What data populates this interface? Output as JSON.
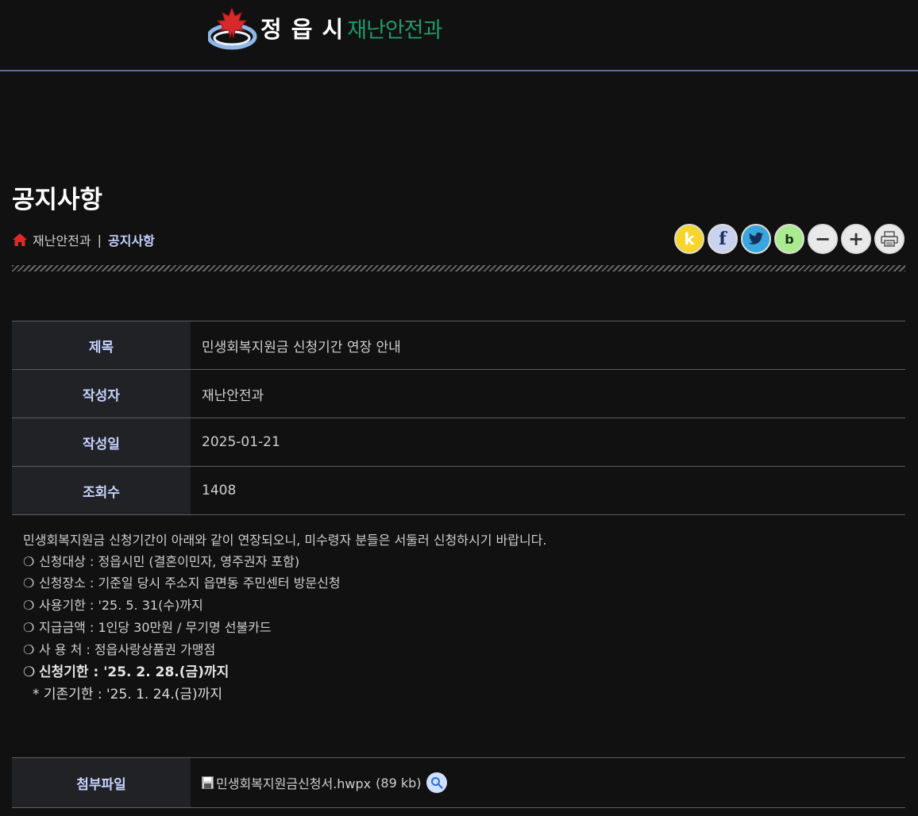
{
  "header": {
    "city": "정 읍 시",
    "dept": "재난안전과"
  },
  "page": {
    "title": "공지사항"
  },
  "breadcrumb": {
    "home_item": "재난안전과",
    "separator": "|",
    "current": "공지사항"
  },
  "tools": [
    {
      "name": "kakao-share-button",
      "icon": "kakao-icon",
      "glyph": "k"
    },
    {
      "name": "facebook-share-button",
      "icon": "facebook-icon",
      "glyph": "f"
    },
    {
      "name": "twitter-share-button",
      "icon": "twitter-icon",
      "glyph": ""
    },
    {
      "name": "band-share-button",
      "icon": "band-icon",
      "glyph": "b"
    },
    {
      "name": "zoom-out-button",
      "icon": "minus-icon",
      "glyph": "−"
    },
    {
      "name": "zoom-in-button",
      "icon": "plus-icon",
      "glyph": "+"
    },
    {
      "name": "print-button",
      "icon": "printer-icon",
      "glyph": ""
    }
  ],
  "info": {
    "subject_label": "제목",
    "subject": "민생회복지원금 신청기간 연장 안내",
    "author_label": "작성자",
    "author": "재난안전과",
    "date_label": "작성일",
    "date": "2025-01-21",
    "views_label": "조회수",
    "views": "1408"
  },
  "content": {
    "intro": "민생회복지원금 신청기간이 아래와 같이 연장되오니, 미수령자 분들은 서둘러 신청하시기 바랍니다.",
    "bullet": "❍",
    "items": [
      "신청대상 : 정읍시민 (결혼이민자, 영주권자 포함)",
      "신청장소 : 기준일 당시 주소지 읍면동 주민센터 방문신청",
      "사용기한 :  '25. 5. 31(수)까지",
      "지급금액 : 1인당 30만원 / 무기명 선불카드",
      "사 용 처 : 정읍사랑상품권 가맹점"
    ],
    "deadline": "신청기한 : '25. 2. 28.(금)까지",
    "prior": "* 기존기한 : '25. 1. 24.(금)까지"
  },
  "attachment": {
    "label": "첨부파일",
    "filename": "민생회복지원금신청서.hwpx",
    "size": "(89 kb)"
  },
  "colors": {
    "background": "#111111",
    "label_bg": "#212226",
    "label_text": "#c6d2ff",
    "header_rule": "#5b6f99",
    "logo_green": "#1f9a68"
  }
}
